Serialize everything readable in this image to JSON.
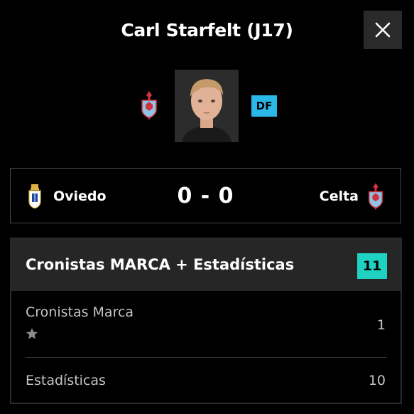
{
  "modal": {
    "title": "Carl Starfelt (J17)",
    "close_icon": "close-icon"
  },
  "player": {
    "position": "DF",
    "team_crest_icon": "celta-crest-icon",
    "photo_icon": "player-photo"
  },
  "match": {
    "home_team": "Oviedo",
    "away_team": "Celta",
    "score": "0 - 0",
    "home_crest_icon": "oviedo-crest-icon",
    "away_crest_icon": "celta-crest-icon"
  },
  "rating": {
    "title": "Cronistas MARCA + Estadísticas",
    "total": "11",
    "rows": [
      {
        "label": "Cronistas Marca",
        "value": "1",
        "icon": "star-icon"
      },
      {
        "label": "Estadísticas",
        "value": "10"
      }
    ]
  },
  "colors": {
    "background": "#000000",
    "position_badge": "#29b8e8",
    "total_badge": "#1fd1c1",
    "header_bg": "#262626"
  }
}
